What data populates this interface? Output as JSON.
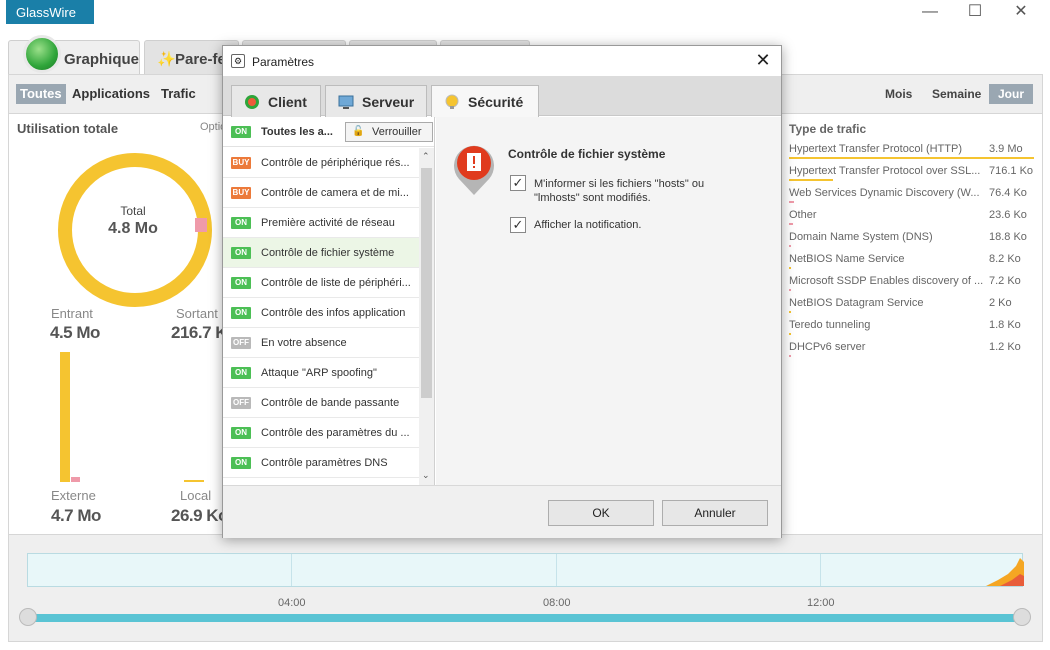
{
  "app": {
    "name": "GlassWire",
    "window_controls": {
      "minimize": "—",
      "maximize": "☐",
      "close": "✕"
    }
  },
  "main_tabs": [
    {
      "label": "Graphique"
    },
    {
      "label": "Pare-feu"
    }
  ],
  "filters": [
    {
      "label": "Toutes"
    },
    {
      "label": "Applications"
    },
    {
      "label": "Trafic"
    }
  ],
  "periods": [
    {
      "label": "Mois"
    },
    {
      "label": "Semaine"
    },
    {
      "label": "Jour"
    }
  ],
  "usage": {
    "title": "Utilisation totale",
    "options_partial": "Optio",
    "total_label": "Total",
    "total_value": "4.8 Mo",
    "incoming_label": "Entrant",
    "incoming_value": "4.5 Mo",
    "outgoing_label": "Sortant",
    "outgoing_value": "216.7 Ko",
    "external_label": "Externe",
    "external_value": "4.7 Mo",
    "local_label": "Local",
    "local_value": "26.9 Ko",
    "incoming_fraction": 0.955,
    "outgoing_fraction": 0.045,
    "external_fraction": 0.995,
    "local_fraction": 0.005
  },
  "traffic": {
    "title": "Type de trafic",
    "rows": [
      {
        "name": "Hypertext Transfer Protocol (HTTP)",
        "value": "3.9 Mo",
        "fraction": 1.0
      },
      {
        "name": "Hypertext Transfer Protocol over SSL...",
        "value": "716.1 Ko",
        "fraction": 0.18
      },
      {
        "name": "Web Services Dynamic Discovery (W...",
        "value": "76.4 Ko",
        "fraction": 0.02
      },
      {
        "name": "Other",
        "value": "23.6 Ko",
        "fraction": 0.01
      },
      {
        "name": "Domain Name System (DNS)",
        "value": "18.8 Ko",
        "fraction": 0.0
      },
      {
        "name": "NetBIOS Name Service",
        "value": "8.2 Ko",
        "fraction": 0.0
      },
      {
        "name": "Microsoft SSDP Enables discovery of ...",
        "value": "7.2 Ko",
        "fraction": 0.0
      },
      {
        "name": "NetBIOS Datagram Service",
        "value": "2 Ko",
        "fraction": 0.0
      },
      {
        "name": "Teredo tunneling",
        "value": "1.8 Ko",
        "fraction": 0.0
      },
      {
        "name": "DHCPv6 server",
        "value": "1.2 Ko",
        "fraction": 0.0
      }
    ]
  },
  "timeline": {
    "ticks": [
      "04:00",
      "08:00",
      "12:00"
    ]
  },
  "dialog": {
    "title": "Paramètres",
    "tabs": [
      {
        "label": "Client"
      },
      {
        "label": "Serveur"
      },
      {
        "label": "Sécurité"
      }
    ],
    "header": {
      "badge": "ON",
      "label": "Toutes les a...",
      "lock_button": "Verrouiller"
    },
    "items": [
      {
        "badge": "BUY",
        "label": "Contrôle de périphérique rés..."
      },
      {
        "badge": "BUY",
        "label": "Contrôle de camera et de mi..."
      },
      {
        "badge": "ON",
        "label": "Première activité de réseau"
      },
      {
        "badge": "ON",
        "label": "Contrôle de fichier système"
      },
      {
        "badge": "ON",
        "label": "Contrôle de liste de périphéri..."
      },
      {
        "badge": "ON",
        "label": "Contrôle des infos application"
      },
      {
        "badge": "OFF",
        "label": "En votre absence"
      },
      {
        "badge": "ON",
        "label": "Attaque \"ARP spoofing\""
      },
      {
        "badge": "OFF",
        "label": "Contrôle de bande passante"
      },
      {
        "badge": "ON",
        "label": "Contrôle des paramètres du ..."
      },
      {
        "badge": "ON",
        "label": "Contrôle paramètres DNS"
      }
    ],
    "detail": {
      "title": "Contrôle de fichier système",
      "option1": "M'informer si les fichiers \"hosts\" ou \"lmhosts\"  sont modifiés.",
      "option2": "Afficher la notification.",
      "check_mark": "✓"
    },
    "ok_button": "OK",
    "cancel_button": "Annuler"
  },
  "colors": {
    "accent": "#1a7fa8",
    "donut_main": "#f5c430",
    "donut_out": "#ef9aa9",
    "on": "#4cbf55",
    "buy": "#ec7a3a",
    "off": "#b9b9b9"
  }
}
